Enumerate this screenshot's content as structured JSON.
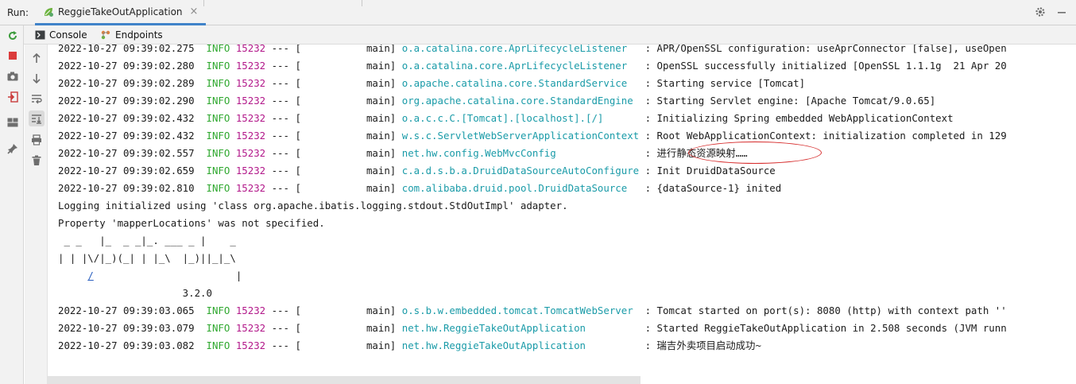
{
  "run_bar": {
    "label": "Run:",
    "tab_title": "ReggieTakeOutApplication",
    "close_glyph": "×",
    "icons": [
      "spring-leaf-icon",
      "settings-icon",
      "minimize-icon"
    ]
  },
  "sub_tabs": [
    {
      "label": "Console",
      "icon": "console-icon"
    },
    {
      "label": "Endpoints",
      "icon": "endpoints-icon"
    }
  ],
  "toolbar": {
    "left": [
      "rerun-icon",
      "stop-icon",
      "screenshot-icon",
      "exit-icon",
      "layout-icon",
      "pin-icon"
    ],
    "right": [
      "up-arrow-icon",
      "down-arrow-icon",
      "soft-wrap-icon",
      "scroll-to-end-icon",
      "print-icon",
      "trash-icon"
    ]
  },
  "console": {
    "lines": [
      {
        "ts": "2022-10-27 09:39:02.275",
        "level": "INFO",
        "pid": "15232",
        "sep": "---",
        "thread": "[           main]",
        "logger": "o.a.catalina.core.AprLifecycleListener  ",
        "msg": ": APR/OpenSSL configuration: useAprConnector [false], useOpen"
      },
      {
        "ts": "2022-10-27 09:39:02.280",
        "level": "INFO",
        "pid": "15232",
        "sep": "---",
        "thread": "[           main]",
        "logger": "o.a.catalina.core.AprLifecycleListener  ",
        "msg": ": OpenSSL successfully initialized [OpenSSL 1.1.1g  21 Apr 20"
      },
      {
        "ts": "2022-10-27 09:39:02.289",
        "level": "INFO",
        "pid": "15232",
        "sep": "---",
        "thread": "[           main]",
        "logger": "o.apache.catalina.core.StandardService  ",
        "msg": ": Starting service [Tomcat]"
      },
      {
        "ts": "2022-10-27 09:39:02.290",
        "level": "INFO",
        "pid": "15232",
        "sep": "---",
        "thread": "[           main]",
        "logger": "org.apache.catalina.core.StandardEngine ",
        "msg": ": Starting Servlet engine: [Apache Tomcat/9.0.65]"
      },
      {
        "ts": "2022-10-27 09:39:02.432",
        "level": "INFO",
        "pid": "15232",
        "sep": "---",
        "thread": "[           main]",
        "logger": "o.a.c.c.C.[Tomcat].[localhost].[/]      ",
        "msg": ": Initializing Spring embedded WebApplicationContext"
      },
      {
        "ts": "2022-10-27 09:39:02.432",
        "level": "INFO",
        "pid": "15232",
        "sep": "---",
        "thread": "[           main]",
        "logger": "w.s.c.ServletWebServerApplicationContext",
        "msg": ": Root WebApplicationContext: initialization completed in 129"
      },
      {
        "ts": "2022-10-27 09:39:02.557",
        "level": "INFO",
        "pid": "15232",
        "sep": "---",
        "thread": "[           main]",
        "logger": "net.hw.config.WebMvcConfig              ",
        "msg": ": 进行静态资源映射……"
      },
      {
        "ts": "2022-10-27 09:39:02.659",
        "level": "INFO",
        "pid": "15232",
        "sep": "---",
        "thread": "[           main]",
        "logger": "c.a.d.s.b.a.DruidDataSourceAutoConfigure",
        "msg": ": Init DruidDataSource"
      },
      {
        "ts": "2022-10-27 09:39:02.810",
        "level": "INFO",
        "pid": "15232",
        "sep": "---",
        "thread": "[           main]",
        "logger": "com.alibaba.druid.pool.DruidDataSource  ",
        "msg": ": {dataSource-1} inited"
      }
    ],
    "plain_lines": [
      "Logging initialized using 'class org.apache.ibatis.logging.stdout.StdOutImpl' adapter.",
      "Property 'mapperLocations' was not specified."
    ],
    "banner": [
      " _ _   |_  _ _|_. ___ _ |    _ ",
      "| | |\\/|_)(_| | |_\\  |_)||_|_\\ ",
      "     ",
      "                        |",
      "                     3.2.0"
    ],
    "banner_link": "/",
    "lines2": [
      {
        "ts": "2022-10-27 09:39:03.065",
        "level": "INFO",
        "pid": "15232",
        "sep": "---",
        "thread": "[           main]",
        "logger": "o.s.b.w.embedded.tomcat.TomcatWebServer ",
        "msg": ": Tomcat started on port(s): 8080 (http) with context path ''"
      },
      {
        "ts": "2022-10-27 09:39:03.079",
        "level": "INFO",
        "pid": "15232",
        "sep": "---",
        "thread": "[           main]",
        "logger": "net.hw.ReggieTakeOutApplication         ",
        "msg": ": Started ReggieTakeOutApplication in 2.508 seconds (JVM runn"
      },
      {
        "ts": "2022-10-27 09:39:03.082",
        "level": "INFO",
        "pid": "15232",
        "sep": "---",
        "thread": "[           main]",
        "logger": "net.hw.ReggieTakeOutApplication         ",
        "msg": ": 瑞吉外卖项目启动成功~"
      }
    ]
  },
  "colors": {
    "info": "#2fa82f",
    "pid": "#b2188a",
    "logger": "#1a9ba8",
    "highlight": "#d62a2a",
    "tab_accent": "#4083c9"
  }
}
